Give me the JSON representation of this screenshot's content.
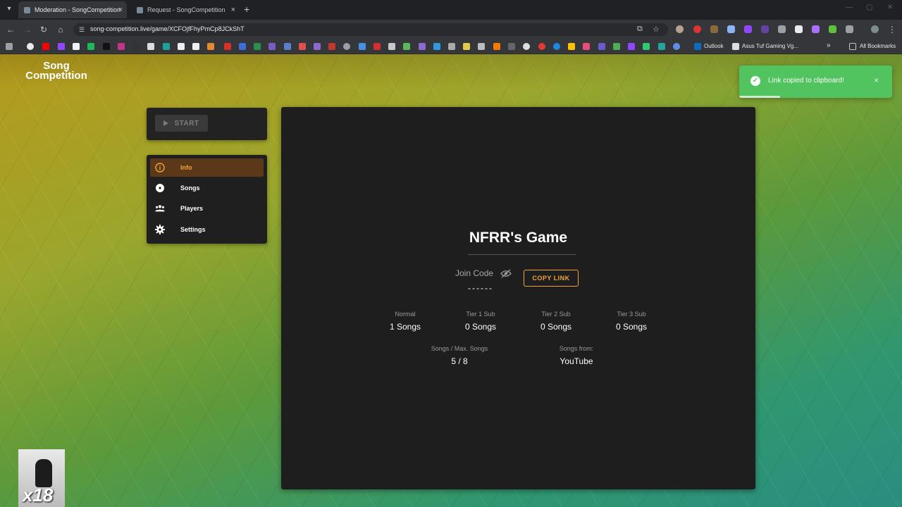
{
  "browser": {
    "tabs": [
      {
        "title": "Moderation - SongCompetition",
        "active": true
      },
      {
        "title": "Request - SongCompetition",
        "active": false
      }
    ],
    "url": "song-competition.live/game/XCFOjfFhyPmCp8JCkShT",
    "bookmarks": {
      "outlook": "Outlook",
      "asus": "Asus Tuf Gaming Vg...",
      "all": "All Bookmarks"
    }
  },
  "logo": {
    "line1": "Song",
    "line2": "Competition"
  },
  "start_button": "START",
  "menu": {
    "items": [
      {
        "label": "Info",
        "icon": "info-icon",
        "active": true
      },
      {
        "label": "Songs",
        "icon": "disc-icon",
        "active": false
      },
      {
        "label": "Players",
        "icon": "people-icon",
        "active": false
      },
      {
        "label": "Settings",
        "icon": "gear-icon",
        "active": false
      }
    ]
  },
  "game": {
    "title": "NFRR's Game",
    "join_code_label": "Join Code",
    "join_code_value": "------",
    "copy_link_label": "COPY LINK",
    "tiers": [
      {
        "label": "Normal",
        "value": "1 Songs"
      },
      {
        "label": "Tier 1 Sub",
        "value": "0 Songs"
      },
      {
        "label": "Tier 2 Sub",
        "value": "0 Songs"
      },
      {
        "label": "Tier 3 Sub",
        "value": "0 Songs"
      }
    ],
    "songs_max_label": "Songs / Max. Songs",
    "songs_max_value": "5 / 8",
    "songs_from_label": "Songs from:",
    "songs_from_value": "YouTube"
  },
  "toast": {
    "message": "Link copied to clipboard!",
    "close": "×"
  },
  "webcam": {
    "multiplier": "x18"
  },
  "colors": {
    "accent": "#f0a33c",
    "panel": "#1e1e1e",
    "toast": "#51c35f"
  }
}
